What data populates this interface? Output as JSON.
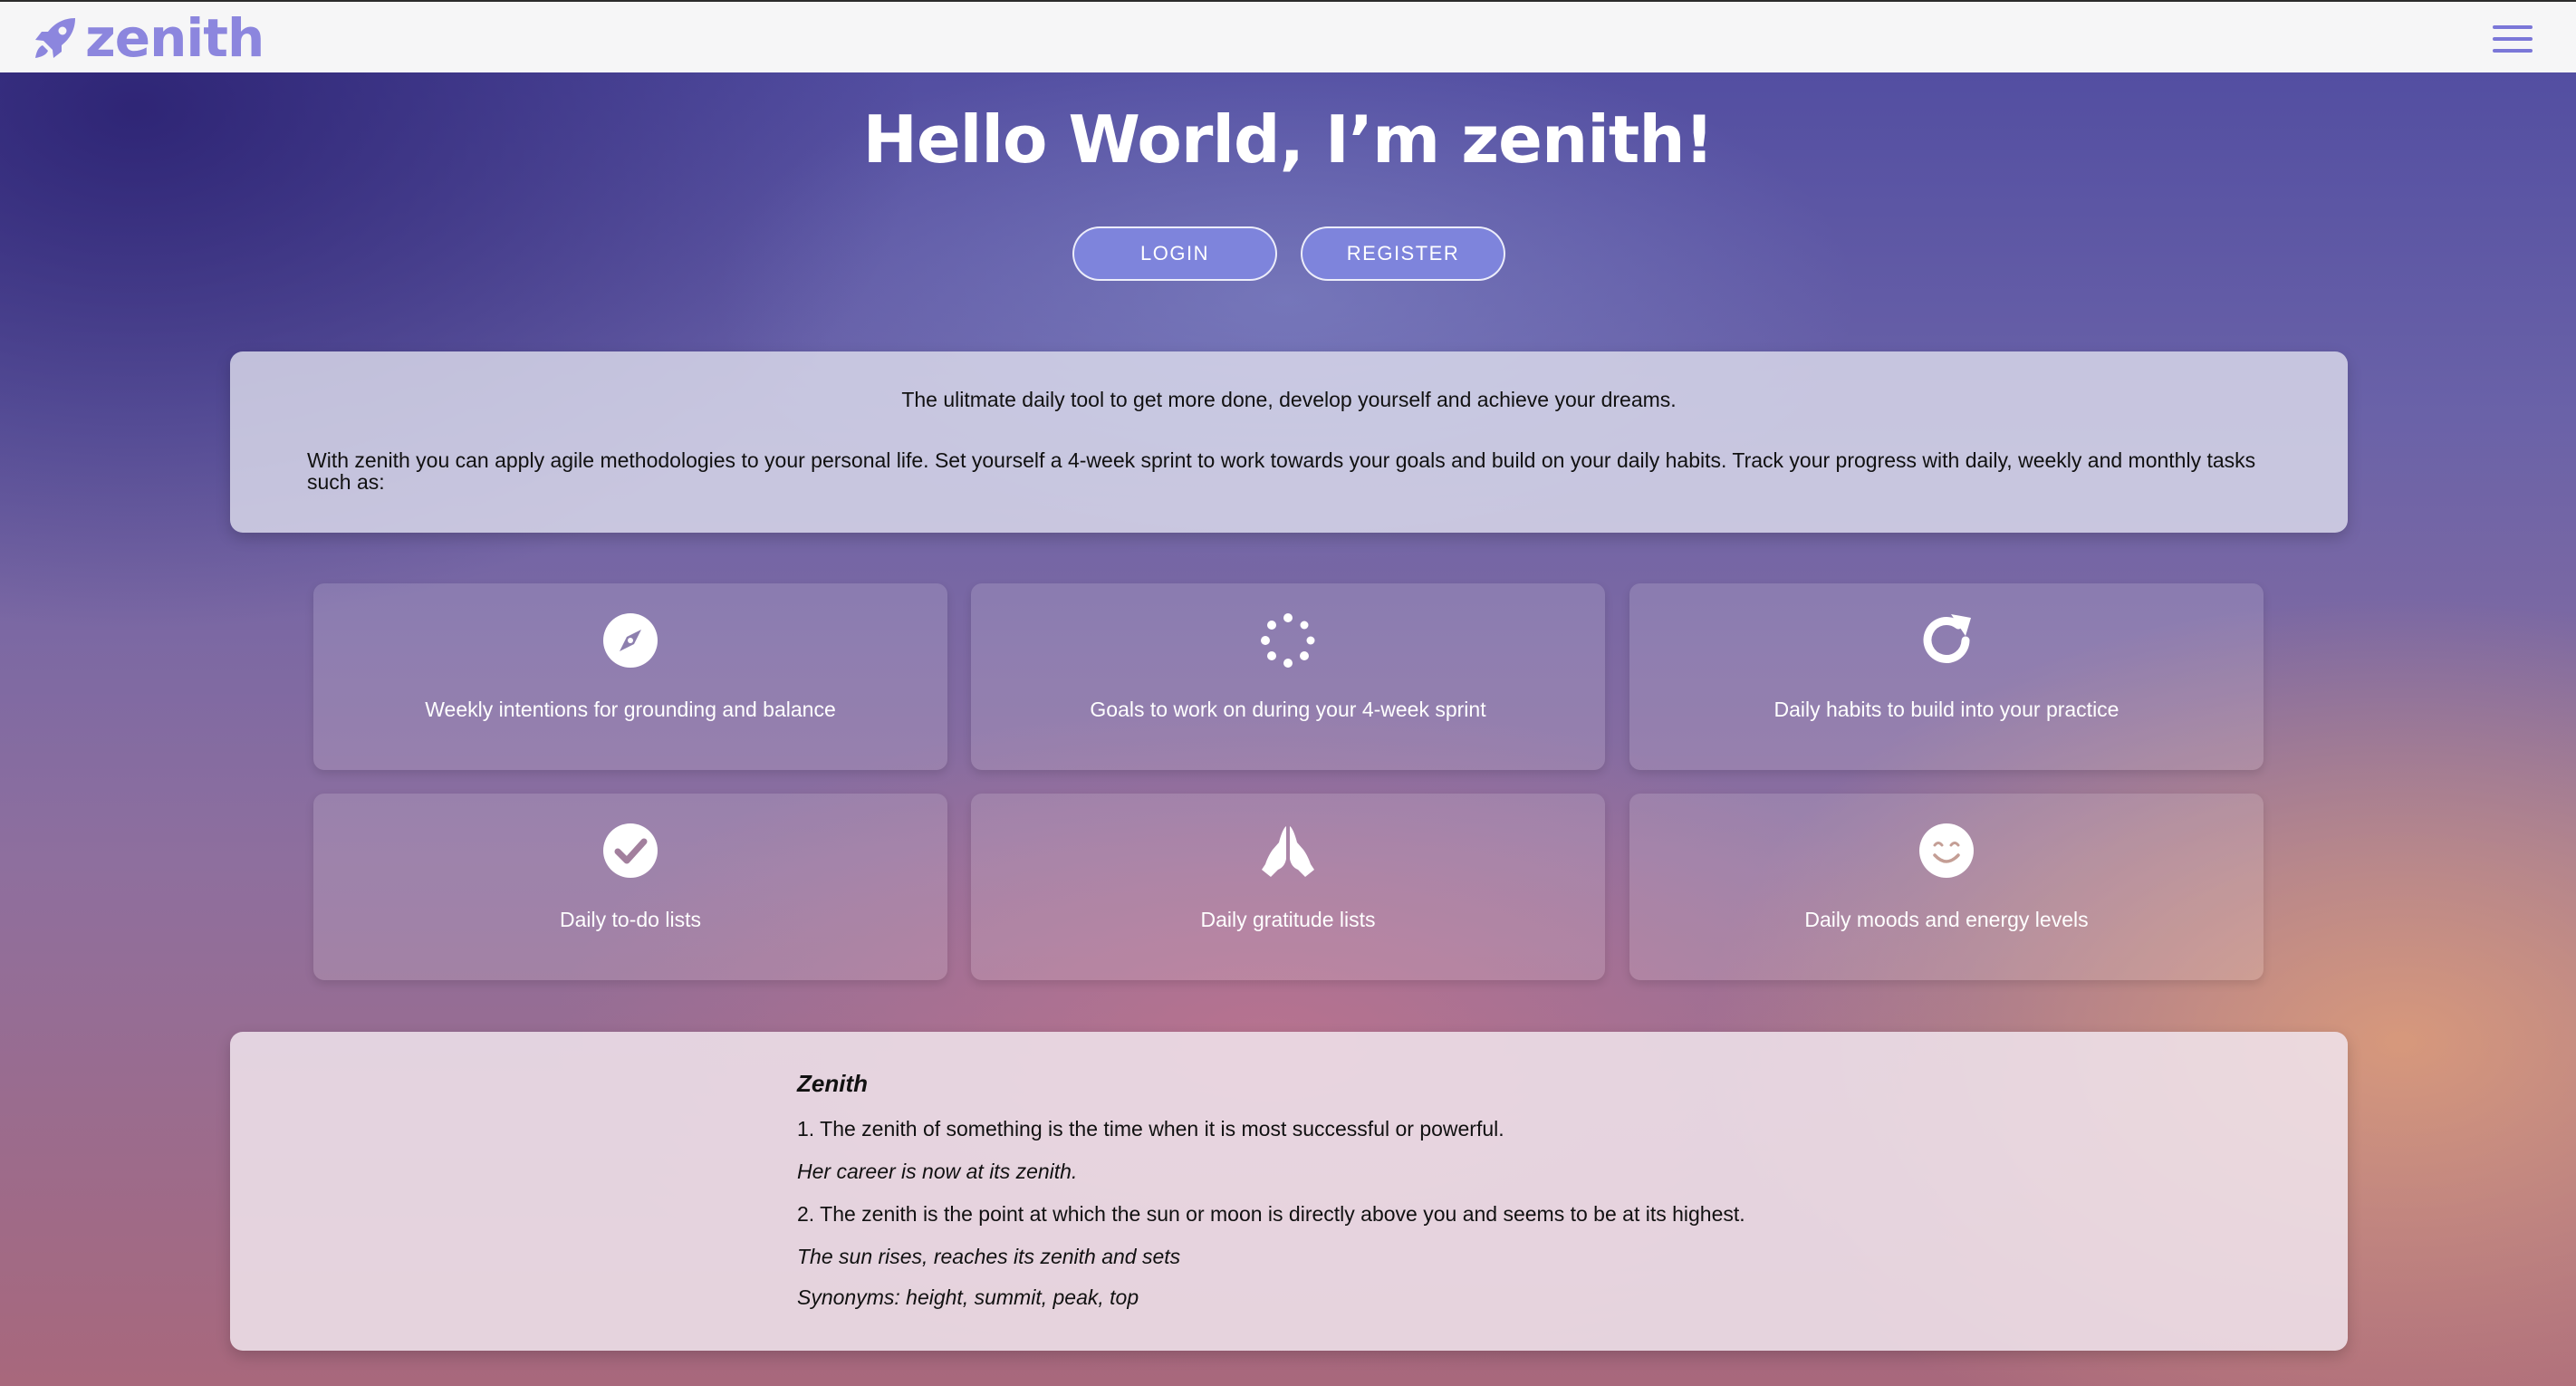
{
  "brand": {
    "name": "zenith",
    "color": "#8c86de"
  },
  "nav": {
    "menu_icon": "hamburger-menu-icon"
  },
  "hero": {
    "title": "Hello World, I’m zenith!"
  },
  "buttons": {
    "login": "LOGIN",
    "register": "REGISTER"
  },
  "intro": {
    "tagline": "The ulitmate daily tool to get more done, develop yourself and achieve your dreams.",
    "description": "With zenith you can apply agile methodologies to your personal life. Set yourself a 4-week sprint to work towards your goals and build on your daily habits. Track your progress with daily, weekly and monthly tasks such as:"
  },
  "features": [
    {
      "icon": "compass-icon",
      "label": "Weekly intentions for grounding and balance"
    },
    {
      "icon": "spinner-icon",
      "label": "Goals to work on during your 4-week sprint"
    },
    {
      "icon": "refresh-icon",
      "label": "Daily habits to build into your practice"
    },
    {
      "icon": "check-circle-icon",
      "label": "Daily to-do lists"
    },
    {
      "icon": "praying-hands-icon",
      "label": "Daily gratitude lists"
    },
    {
      "icon": "smile-icon",
      "label": "Daily moods and energy levels"
    }
  ],
  "definition": {
    "title": "Zenith",
    "meaning_1": "1. The zenith of something is the time when it is most successful or powerful.",
    "example_1": "Her career is now at its zenith.",
    "meaning_2": "2. The zenith is the point at which the sun or moon is directly above you and seems to be at its highest.",
    "example_2": "The sun rises, reaches its zenith and sets",
    "synonyms": "Synonyms: height, summit, peak, top"
  }
}
